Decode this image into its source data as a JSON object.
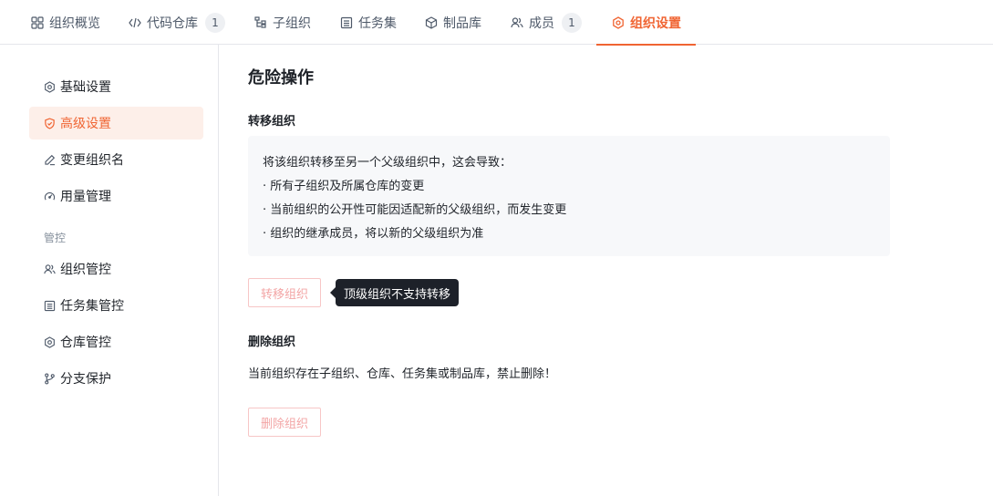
{
  "tabs": [
    {
      "label": "组织概览",
      "icon": "grid-icon",
      "badge": ""
    },
    {
      "label": "代码仓库",
      "icon": "code-icon",
      "badge": "1"
    },
    {
      "label": "子组织",
      "icon": "tree-icon",
      "badge": ""
    },
    {
      "label": "任务集",
      "icon": "list-icon",
      "badge": ""
    },
    {
      "label": "制品库",
      "icon": "cube-icon",
      "badge": ""
    },
    {
      "label": "成员",
      "icon": "users-icon",
      "badge": "1"
    },
    {
      "label": "组织设置",
      "icon": "gear-icon",
      "badge": ""
    }
  ],
  "sidebar": {
    "items": [
      {
        "label": "基础设置",
        "icon": "gear-icon"
      },
      {
        "label": "高级设置",
        "icon": "shield-icon"
      },
      {
        "label": "变更组织名",
        "icon": "edit-icon"
      },
      {
        "label": "用量管理",
        "icon": "gauge-icon"
      }
    ],
    "group_label": "管控",
    "group_items": [
      {
        "label": "组织管控",
        "icon": "users-icon"
      },
      {
        "label": "任务集管控",
        "icon": "list-icon"
      },
      {
        "label": "仓库管控",
        "icon": "gear-icon"
      },
      {
        "label": "分支保护",
        "icon": "branch-icon"
      }
    ]
  },
  "main": {
    "title": "危险操作",
    "transfer": {
      "title": "转移组织",
      "intro": "将该组织转移至另一个父级组织中，这会导致：",
      "bullets": [
        "· 所有子组织及所属仓库的变更",
        "· 当前组织的公开性可能因适配新的父级组织，而发生变更",
        "· 组织的继承成员，将以新的父级组织为准"
      ],
      "button": "转移组织",
      "tooltip": "顶级组织不支持转移"
    },
    "delete": {
      "title": "删除组织",
      "message": "当前组织存在子组织、仓库、任务集或制品库，禁止删除！",
      "button": "删除组织"
    }
  },
  "colors": {
    "accent": "#f06432",
    "active_bg": "#fdefe9",
    "danger_border": "#f7c6c6",
    "tooltip_bg": "#1d2129"
  }
}
